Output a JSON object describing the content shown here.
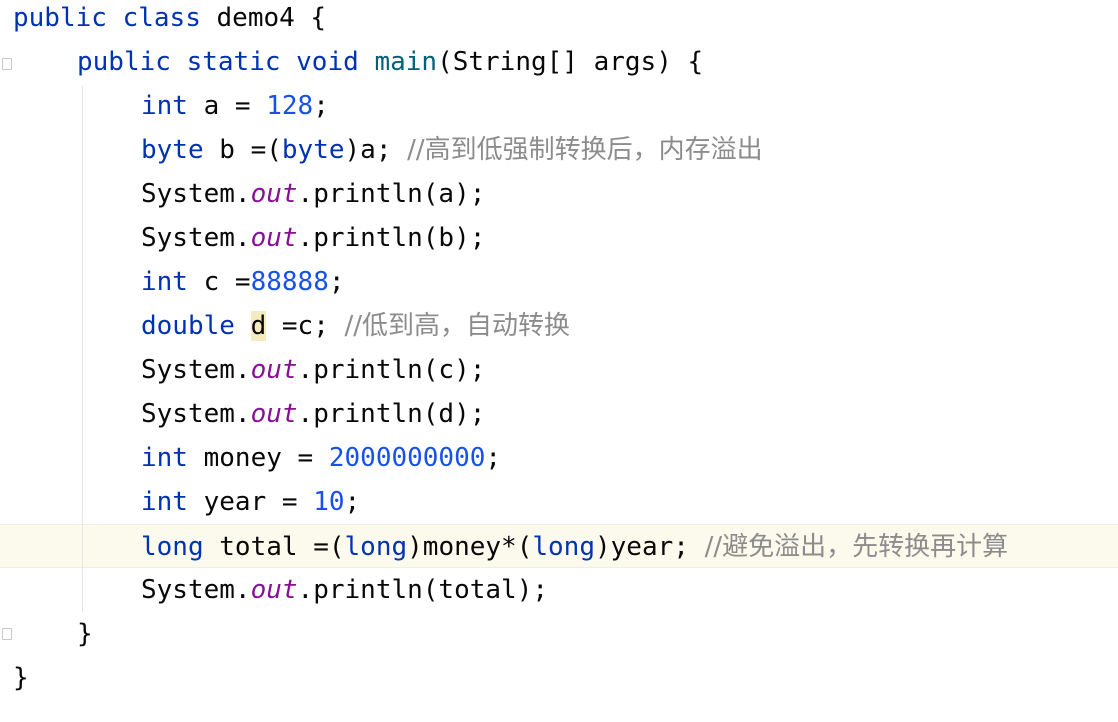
{
  "editor": {
    "language": "java",
    "lines": [
      {
        "tokens": [
          {
            "t": "public",
            "k": "kw"
          },
          {
            "t": " ",
            "k": "plain"
          },
          {
            "t": "class",
            "k": "kw"
          },
          {
            "t": " demo4 {",
            "k": "plain"
          }
        ]
      },
      {
        "tokens": [
          {
            "t": "public",
            "k": "kw"
          },
          {
            "t": " ",
            "k": "plain"
          },
          {
            "t": "static",
            "k": "kw"
          },
          {
            "t": " ",
            "k": "plain"
          },
          {
            "t": "void",
            "k": "kw"
          },
          {
            "t": " ",
            "k": "plain"
          },
          {
            "t": "main",
            "k": "fn"
          },
          {
            "t": "(String[] args) {",
            "k": "plain"
          }
        ]
      },
      {
        "tokens": [
          {
            "t": "int",
            "k": "kw"
          },
          {
            "t": " a = ",
            "k": "plain"
          },
          {
            "t": "128",
            "k": "num"
          },
          {
            "t": ";",
            "k": "plain"
          }
        ]
      },
      {
        "tokens": [
          {
            "t": "byte",
            "k": "kw"
          },
          {
            "t": " b =(",
            "k": "plain"
          },
          {
            "t": "byte",
            "k": "kw"
          },
          {
            "t": ")a; ",
            "k": "plain"
          },
          {
            "t": "//高到低强制转换后，内存溢出",
            "k": "cm"
          }
        ]
      },
      {
        "tokens": [
          {
            "t": "System.",
            "k": "plain"
          },
          {
            "t": "out",
            "k": "field"
          },
          {
            "t": ".println(a);",
            "k": "plain"
          }
        ]
      },
      {
        "tokens": [
          {
            "t": "System.",
            "k": "plain"
          },
          {
            "t": "out",
            "k": "field"
          },
          {
            "t": ".println(b);",
            "k": "plain"
          }
        ]
      },
      {
        "tokens": [
          {
            "t": "int",
            "k": "kw"
          },
          {
            "t": " c =",
            "k": "plain"
          },
          {
            "t": "88888",
            "k": "num"
          },
          {
            "t": ";",
            "k": "plain"
          }
        ]
      },
      {
        "tokens": [
          {
            "t": "double",
            "k": "kw"
          },
          {
            "t": " ",
            "k": "plain"
          },
          {
            "t": "d",
            "k": "hl"
          },
          {
            "t": " =c; ",
            "k": "plain"
          },
          {
            "t": "//低到高，自动转换",
            "k": "cm"
          }
        ]
      },
      {
        "tokens": [
          {
            "t": "System.",
            "k": "plain"
          },
          {
            "t": "out",
            "k": "field"
          },
          {
            "t": ".println(c);",
            "k": "plain"
          }
        ]
      },
      {
        "tokens": [
          {
            "t": "System.",
            "k": "plain"
          },
          {
            "t": "out",
            "k": "field"
          },
          {
            "t": ".println(d);",
            "k": "plain"
          }
        ]
      },
      {
        "tokens": [
          {
            "t": "int",
            "k": "kw"
          },
          {
            "t": " money = ",
            "k": "plain"
          },
          {
            "t": "2000000000",
            "k": "num"
          },
          {
            "t": ";",
            "k": "plain"
          }
        ]
      },
      {
        "tokens": [
          {
            "t": "int",
            "k": "kw"
          },
          {
            "t": " year = ",
            "k": "plain"
          },
          {
            "t": "10",
            "k": "num"
          },
          {
            "t": ";",
            "k": "plain"
          }
        ]
      },
      {
        "tokens": [
          {
            "t": "long",
            "k": "kw"
          },
          {
            "t": " total =(",
            "k": "plain"
          },
          {
            "t": "long",
            "k": "kw"
          },
          {
            "t": ")money*(",
            "k": "plain"
          },
          {
            "t": "long",
            "k": "kw"
          },
          {
            "t": ")year; ",
            "k": "plain"
          },
          {
            "t": "//避免溢出，先转换再计算",
            "k": "cm"
          }
        ]
      },
      {
        "tokens": [
          {
            "t": "System.",
            "k": "plain"
          },
          {
            "t": "out",
            "k": "field"
          },
          {
            "t": ".println(total);",
            "k": "plain"
          }
        ]
      },
      {
        "tokens": [
          {
            "t": "}",
            "k": "plain"
          }
        ]
      },
      {
        "tokens": [
          {
            "t": "}",
            "k": "plain"
          }
        ]
      }
    ]
  },
  "colors": {
    "keyword": "#0033b3",
    "number": "#1750eb",
    "static_field": "#871094",
    "method_declaration": "#00627a",
    "comment": "#8c8c8c",
    "text": "#080808",
    "current_line": "#fcfaed",
    "identifier_highlight": "#f6ebbc"
  }
}
